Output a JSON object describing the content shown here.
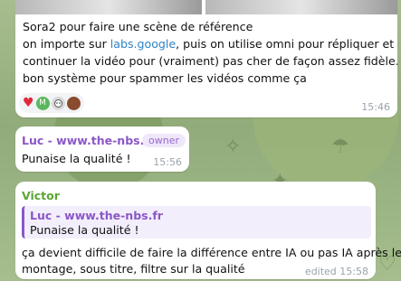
{
  "message1": {
    "line1": "Sora2 pour faire une scène de référence",
    "line2_pre": "on importe sur ",
    "line2_link": "labs.google",
    "line2_post": ", puis on utilise omni pour répliquer et",
    "line3": "continuer la vidéo pour (vraiment) pas cher de façon assez fidèle.",
    "line4": "bon système pour spammer les vidéos comme ça",
    "reaction_heart": "♥",
    "reaction_avatar_letter": "M",
    "time": "15:46"
  },
  "message2": {
    "sender": "Luc - www.the-nbs.fr",
    "badge": "owner",
    "text": "Punaise la qualité !",
    "time": "15:56"
  },
  "message3": {
    "sender": "Victor",
    "quote_sender": "Luc - www.the-nbs.fr",
    "quote_text": "Punaise la qualité !",
    "line1": "ça devient difficile de faire la différence entre IA ou pas IA après le",
    "line2": "montage, sous titre, filtre sur la qualité",
    "time": "edited 15:58"
  },
  "colors": {
    "sender_luc": "#8a57c7",
    "sender_victor": "#5aa634",
    "link": "#2f83c4",
    "wallpaper": "#8fa87b"
  }
}
